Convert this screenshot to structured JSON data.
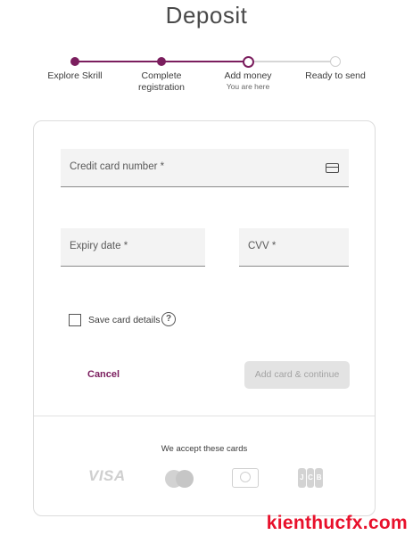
{
  "page": {
    "title": "Deposit"
  },
  "stepper": {
    "steps": [
      {
        "label": "Explore Skrill",
        "state": "done"
      },
      {
        "label": "Complete registration",
        "state": "done"
      },
      {
        "label": "Add money",
        "sub": "You are here",
        "state": "current"
      },
      {
        "label": "Ready to send",
        "state": "todo"
      }
    ]
  },
  "form": {
    "card_number_label": "Credit card number *",
    "expiry_label": "Expiry date *",
    "cvv_label": "CVV *",
    "save_card_label": "Save card details",
    "save_card_checked": false,
    "help_glyph": "?",
    "cancel_label": "Cancel",
    "submit_label": "Add card & continue",
    "submit_enabled": false
  },
  "accepted": {
    "heading": "We accept these cards",
    "brands": [
      "VISA",
      "mastercard-icon",
      "diners-club-icon",
      "JCB"
    ]
  },
  "watermark": "kienthucfx.com",
  "colors": {
    "accent": "#7b1e5e",
    "watermark": "#e8102b",
    "disabled": "#e3e3e3"
  }
}
